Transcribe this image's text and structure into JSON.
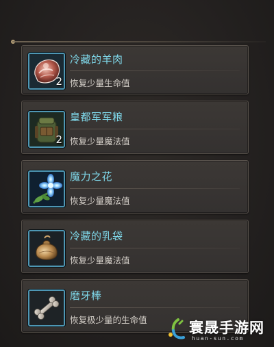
{
  "items": [
    {
      "name": "冷藏的羊肉",
      "description": "恢复少量生命值",
      "quantity": "2",
      "icon": "frozen-mutton-icon"
    },
    {
      "name": "皇都军军粮",
      "description": "恢复少量魔法值",
      "quantity": "2",
      "icon": "army-ration-bag-icon"
    },
    {
      "name": "魔力之花",
      "description": "恢复少量魔法值",
      "quantity": "",
      "icon": "magic-flower-icon"
    },
    {
      "name": "冷藏的乳袋",
      "description": "恢复少量魔法值",
      "quantity": "",
      "icon": "milk-bag-icon"
    },
    {
      "name": "磨牙棒",
      "description": "恢复极少量的生命值",
      "quantity": "",
      "icon": "teething-bone-icon"
    }
  ],
  "watermark": {
    "title": "寰晟手游网",
    "subtitle": "huan-sun.com"
  },
  "colors": {
    "item_name": "#7fd8ea",
    "item_desc": "#d4cfc8",
    "slot_border": "#4e97b4",
    "panel_bg": "#242120"
  }
}
